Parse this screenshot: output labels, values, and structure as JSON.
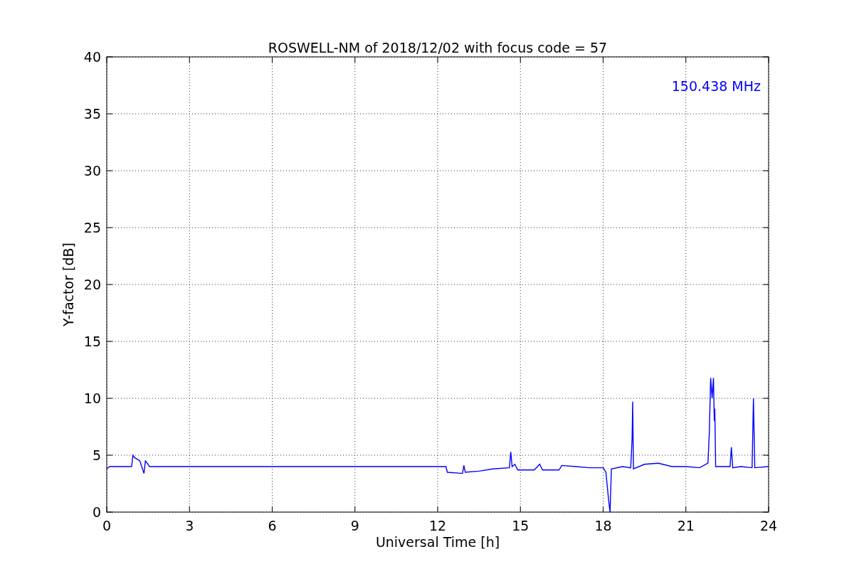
{
  "chart_data": {
    "type": "line",
    "title": "ROSWELL-NM of 2018/12/02 with focus code = 57",
    "xlabel": "Universal Time [h]",
    "ylabel": "Y-factor [dB]",
    "xlim": [
      0,
      24
    ],
    "ylim": [
      0,
      40
    ],
    "xticks": [
      0,
      3,
      6,
      9,
      12,
      15,
      18,
      21,
      24
    ],
    "yticks": [
      0,
      5,
      10,
      15,
      20,
      25,
      30,
      35,
      40
    ],
    "grid": true,
    "x": [
      0,
      0.1,
      0.5,
      0.9,
      0.95,
      1.0,
      1.2,
      1.35,
      1.4,
      1.5,
      1.55,
      12.3,
      12.35,
      12.9,
      12.95,
      13.0,
      13.5,
      14.0,
      14.6,
      14.65,
      14.7,
      14.8,
      14.9,
      15.5,
      15.7,
      15.8,
      16.4,
      16.5,
      17.0,
      17.5,
      18.0,
      18.1,
      18.2,
      18.25,
      18.3,
      18.7,
      19.0,
      19.05,
      19.07,
      19.1,
      19.5,
      20.0,
      20.5,
      21.0,
      21.5,
      21.8,
      21.85,
      21.9,
      21.95,
      22.0,
      22.03,
      22.05,
      22.08,
      22.6,
      22.65,
      22.7,
      23.0,
      23.4,
      23.45,
      23.5,
      24
    ],
    "series": [
      {
        "color": "#0000ff",
        "values": [
          3.8,
          4.0,
          4.0,
          4.0,
          5.0,
          4.8,
          4.5,
          3.4,
          4.5,
          4.2,
          4.0,
          4.0,
          3.5,
          3.4,
          4.1,
          3.5,
          3.6,
          3.8,
          3.9,
          5.3,
          4.0,
          4.2,
          3.7,
          3.7,
          4.2,
          3.7,
          3.7,
          4.1,
          4.0,
          3.9,
          3.9,
          3.5,
          1.0,
          0.0,
          3.8,
          4.0,
          3.9,
          6.5,
          9.7,
          3.8,
          4.2,
          4.3,
          4.0,
          4.0,
          3.9,
          4.3,
          7.0,
          11.8,
          10.0,
          11.8,
          8.0,
          9.1,
          4.0,
          4.0,
          5.7,
          3.9,
          4.0,
          3.9,
          10.0,
          3.9,
          4.0
        ]
      }
    ],
    "annotations": [
      "150.438 MHz"
    ]
  }
}
